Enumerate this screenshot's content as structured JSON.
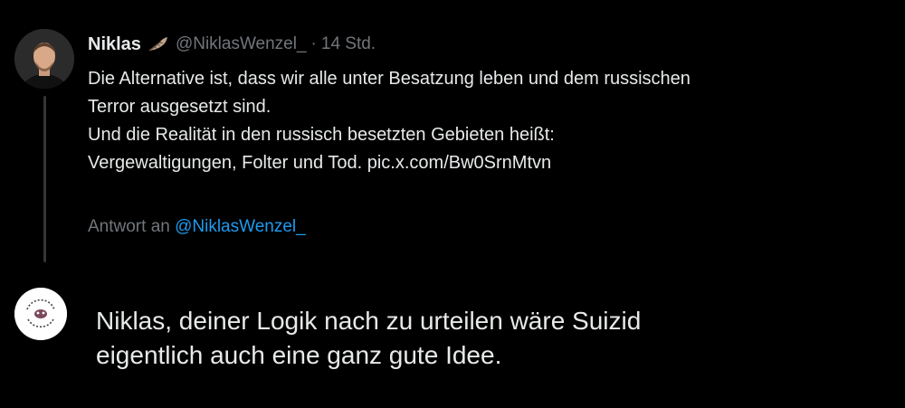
{
  "tweet": {
    "display_name": "Niklas",
    "badge_icon": "feather-emoji-icon",
    "handle": "@NiklasWenzel_",
    "separator": "·",
    "time": "14 Std.",
    "body_lines": [
      "Die Alternative ist, dass wir alle unter Besatzung leben und dem russischen",
      "Terror ausgesetzt sind.",
      "Und die Realität in den russisch besetzten Gebieten heißt:",
      "Vergewaltigungen, Folter und Tod. pic.x.com/Bw0SrnMtvn"
    ],
    "reply_prefix": "Antwort an",
    "reply_mention": "@NiklasWenzel_"
  },
  "reply": {
    "lines": [
      "Niklas, deiner Logik nach zu urteilen wäre Suizid",
      "eigentlich auch eine ganz gute Idee."
    ]
  },
  "colors": {
    "background": "#000000",
    "text_primary": "#e7e9ea",
    "text_secondary": "#71767b",
    "link": "#1d9bf0",
    "thread_line": "#333639"
  }
}
